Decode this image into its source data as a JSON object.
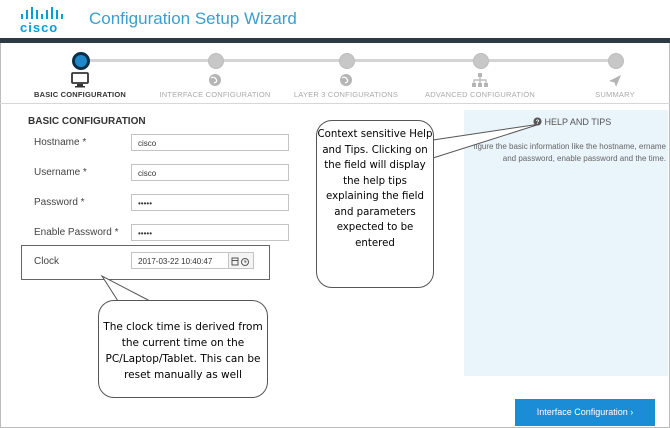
{
  "app": {
    "logo_text": "cisco",
    "title": "Configuration Setup Wizard"
  },
  "wizard": {
    "steps": [
      {
        "label": "BASIC CONFIGURATION",
        "icon": "monitor-icon",
        "active": true
      },
      {
        "label": "INTERFACE CONFIGURATION",
        "icon": "globe-icon",
        "active": false
      },
      {
        "label": "LAYER 3 CONFIGURATIONS",
        "icon": "globe-icon",
        "active": false
      },
      {
        "label": "ADVANCED CONFIGURATION",
        "icon": "network-icon",
        "active": false
      },
      {
        "label": "SUMMARY",
        "icon": "send-icon",
        "active": false
      }
    ]
  },
  "form": {
    "section_title": "BASIC CONFIGURATION",
    "hostname": {
      "label": "Hostname *",
      "value": "cisco"
    },
    "username": {
      "label": "Username *",
      "value": "cisco"
    },
    "password": {
      "label": "Password *",
      "value": "•••••"
    },
    "enable_password": {
      "label": "Enable Password *",
      "value": "•••••"
    },
    "clock": {
      "label": "Clock",
      "value": "2017-03-22 10:40:47"
    }
  },
  "help": {
    "title": "HELP AND TIPS",
    "text": "figure the basic information like the hostname, ername and password, enable password and the time."
  },
  "callouts": {
    "help_note": "Context sensitive Help and Tips. Clicking on the field will display the help tips explaining the field and parameters expected to be entered",
    "clock_note": "The clock time is derived from the current time on the PC/Laptop/Tablet. This can be reset manually as well"
  },
  "footer": {
    "next_label": "Interface Configuration ›"
  },
  "colors": {
    "accent": "#1a8dd6",
    "header_bar": "#2d3a44",
    "help_bg": "#eaf4fb"
  }
}
